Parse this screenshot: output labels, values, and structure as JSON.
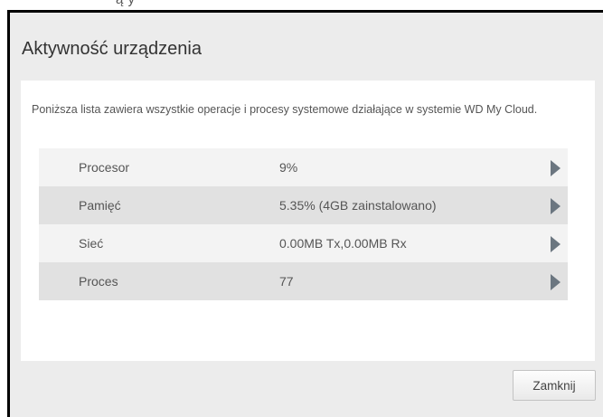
{
  "dialog": {
    "title": "Aktywność urządzenia",
    "description": "Poniższa lista zawiera wszystkie operacje i procesy systemowe działające w systemie WD My Cloud.",
    "close_label": "Zamknij"
  },
  "activity_rows": [
    {
      "label": "Procesor",
      "value": "9%",
      "icon": "chevron-right-icon"
    },
    {
      "label": "Pamięć",
      "value": "5.35% (4GB zainstalowano)",
      "icon": "chevron-right-icon"
    },
    {
      "label": "Sieć",
      "value": "0.00MB Tx,0.00MB Rx",
      "icon": "chevron-right-icon"
    },
    {
      "label": "Proces",
      "value": "77",
      "icon": "chevron-right-icon"
    }
  ],
  "colors": {
    "dialog_background": "#ececec",
    "panel_background": "#ffffff",
    "row_light": "#f3f3f3",
    "row_dark": "#e1e1e1",
    "arrow": "#6b7680"
  }
}
